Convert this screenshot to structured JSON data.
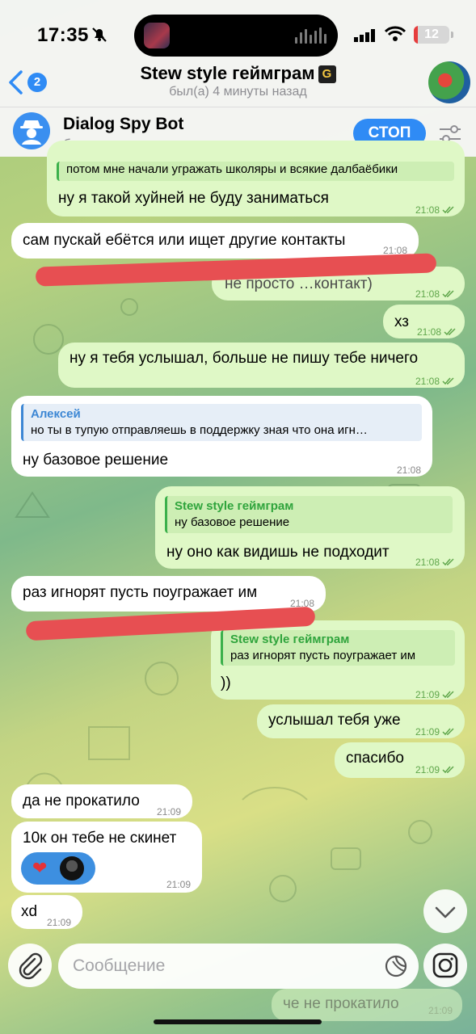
{
  "status_bar": {
    "time": "17:35",
    "battery": "12",
    "battery_level": 0.12
  },
  "header": {
    "back_count": "2",
    "title": "Stew style геймграм",
    "title_badge": "G",
    "subtitle": "был(а) 4 минуты назад"
  },
  "bot_bar": {
    "name": "Dialog Spy Bot",
    "description": "бот управляет этим чатом",
    "stop_label": "СТОП"
  },
  "messages": {
    "m0": {
      "reply_text": "потом мне начали угражать школяры и всякие далбаёбики",
      "text": "ну я такой хуйней не буду заниматься",
      "time": "21:08"
    },
    "m1": {
      "text": "сам пускай ебётся или ищет другие контакты",
      "time": "21:08"
    },
    "m2": {
      "text": "не просто …контакт)",
      "time": "21:08"
    },
    "m3": {
      "text": "хз",
      "time": "21:08"
    },
    "m4": {
      "text": "ну я тебя услышал, больше не пишу тебе ничего",
      "time": "21:08"
    },
    "m5": {
      "reply_name": "Алексей",
      "reply_text": "но ты в тупую отправляешь в поддержку зная что она игн…",
      "text": "ну базовое решение",
      "time": "21:08"
    },
    "m6": {
      "reply_name": "Stew style геймграм",
      "reply_text": "ну базовое решение",
      "text": "ну оно как видишь не подходит",
      "time": "21:08"
    },
    "m7": {
      "text": "раз игнорят пусть поугражает им",
      "time": "21:08"
    },
    "m8": {
      "reply_name": "Stew style геймграм",
      "reply_text": "раз игнорят пусть поугражает им",
      "text": "))",
      "time": "21:09"
    },
    "m9": {
      "text": "услышал тебя уже",
      "time": "21:09"
    },
    "m10": {
      "text": "спасибо",
      "time": "21:09"
    },
    "m11": {
      "text": "да не прокатило",
      "time": "21:09"
    },
    "m12": {
      "text": "10к он тебе не скинет",
      "time": "21:09",
      "reaction": "❤"
    },
    "m13": {
      "text": "xd",
      "time": "21:09"
    },
    "m14": {
      "text": "че не прокатило",
      "time": "21:09"
    }
  },
  "composer": {
    "placeholder": "Сообщение"
  },
  "colors": {
    "accent": "#2f8bf5",
    "outgoing_bubble": "#dff8c6",
    "incoming_bubble": "#ffffff",
    "scribble": "#e74f52",
    "reply_green": "#2fa43c",
    "reply_blue": "#3d87d4"
  },
  "icons": {
    "status": [
      "bell-off-icon",
      "signal-icon",
      "wifi-icon",
      "battery-icon"
    ],
    "header": [
      "chevron-left-icon",
      "settings-sliders-icon"
    ],
    "composer": [
      "paperclip-icon",
      "sticker-icon",
      "camera-icon"
    ],
    "scroll": "chevron-down-icon"
  }
}
